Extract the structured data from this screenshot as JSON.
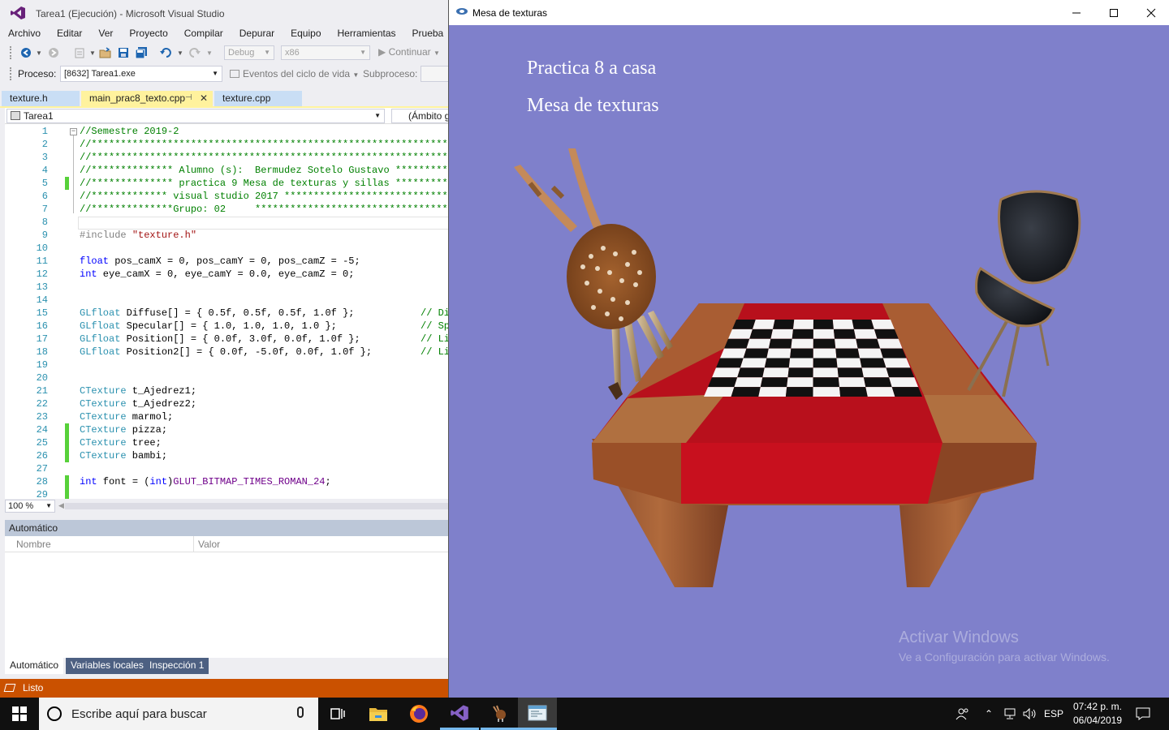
{
  "vs": {
    "title": "Tarea1 (Ejecución) - Microsoft Visual Studio",
    "menu": [
      "Archivo",
      "Editar",
      "Ver",
      "Proyecto",
      "Compilar",
      "Depurar",
      "Equipo",
      "Herramientas",
      "Prueba"
    ],
    "toolbar": {
      "config": "Debug",
      "platform": "x86",
      "continue": "Continuar"
    },
    "process_label": "Proceso:",
    "process_value": "[8632] Tarea1.exe",
    "lifecycle_label": "Eventos del ciclo de vida",
    "subprocess_label": "Subproceso:",
    "tabs": [
      {
        "label": "texture.h"
      },
      {
        "label": "main_prac8_texto.cpp"
      },
      {
        "label": "texture.cpp"
      }
    ],
    "nav_project": "Tarea1",
    "nav_scope": "(Ámbito gl",
    "zoom": "100 %",
    "autos_title": "Automático",
    "autos_col_name": "Nombre",
    "autos_col_value": "Valor",
    "bottom_tabs": [
      "Automático",
      "Variables locales",
      "Inspección 1"
    ],
    "status": "Listo"
  },
  "code": {
    "line_numbers": [
      "1",
      "2",
      "3",
      "4",
      "5",
      "6",
      "7",
      "8",
      "9",
      "10",
      "11",
      "12",
      "13",
      "14",
      "15",
      "16",
      "17",
      "18",
      "19",
      "20",
      "21",
      "22",
      "23",
      "24",
      "25",
      "26",
      "27",
      "28",
      "29"
    ],
    "l1": "//Semestre 2019-2",
    "l2": "//*************************************************************",
    "l3": "//*************************************************************",
    "l4": "//************** Alumno (s):  Bermudez Sotelo Gustavo **********",
    "l5": "//************** practica 9 Mesa de texturas y sillas **********",
    "l6": "//************* visual studio 2017 ****************************",
    "l7": "//**************Grupo: 02     *********************************",
    "l9_a": "#include ",
    "l9_b": "\"texture.h\"",
    "l11_kw": "float",
    "l11": " pos_camX = 0, pos_camY = 0, pos_camZ = -5;",
    "l12_kw": "int",
    "l12": " eye_camX = 0, eye_camY = 0.0, eye_camZ = 0;",
    "l15_ty": "GLfloat",
    "l15": " Diffuse[] = { 0.5f, 0.5f, 0.5f, 1.0f };",
    "l15_cm": "// Di",
    "l16_ty": "GLfloat",
    "l16": " Specular[] = { 1.0, 1.0, 1.0, 1.0 };",
    "l16_cm": "// Sp",
    "l17_ty": "GLfloat",
    "l17": " Position[] = { 0.0f, 3.0f, 0.0f, 1.0f };",
    "l17_cm": "// Li",
    "l18_ty": "GLfloat",
    "l18": " Position2[] = { 0.0f, -5.0f, 0.0f, 1.0f };",
    "l18_cm": "// Li",
    "ctexture": "CTexture",
    "l21": " t_Ajedrez1;",
    "l22": " t_Ajedrez2;",
    "l23": " marmol;",
    "l24": " pizza;",
    "l25": " tree;",
    "l26": " bambi;",
    "l28_kw": "int",
    "l28_a": " font = (",
    "l28_kw2": "int",
    "l28_b": ")",
    "l28_c": "GLUT_BITMAP_TIMES_ROMAN_24",
    "l28_d": ";"
  },
  "gl": {
    "title": "Mesa de texturas",
    "text1": "Practica 8 a casa",
    "text2": "Mesa de texturas",
    "watermark_title": "Activar Windows",
    "watermark_sub": "Ve a Configuración para activar Windows."
  },
  "taskbar": {
    "search_placeholder": "Escribe aquí para buscar",
    "lang": "ESP",
    "time": "07:42 p. m.",
    "date": "06/04/2019"
  },
  "colors": {
    "vs_status": "#ca5100",
    "gl_background": "#7f80cb",
    "tab_active": "#fff29d",
    "tablecloth": "#b8101c"
  }
}
